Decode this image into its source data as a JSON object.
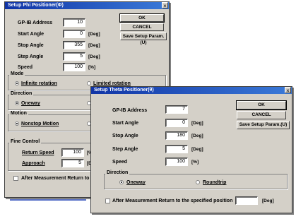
{
  "phi": {
    "title": "Setup Phi Positioner(Φ)",
    "gpib_label": "GP-IB Address",
    "gpib_value": "10",
    "start_label": "Start Angle",
    "start_value": "0",
    "stop_label": "Stop Angle",
    "stop_value": "355",
    "step_label": "Step Angle",
    "step_value": "5",
    "speed_label": "Speed",
    "speed_value": "100",
    "deg_unit": "[Deg]",
    "pct_unit": "[%]",
    "ok": "OK",
    "cancel": "CANCEL",
    "save": "Save Setup Param.(U)",
    "mode_title": "Mode",
    "mode_infinite": "Infinite rotation",
    "mode_limited": "Limited rotation",
    "direction_title": "Direction",
    "direction_oneway": "Oneway",
    "direction_partial": "R",
    "motion_title": "Motion",
    "motion_nonstop": "Nonstop Motion",
    "motion_partial": "S",
    "fine_title": "Fine Control",
    "return_speed_label": "Return Speed",
    "return_speed_value": "100",
    "return_unit_partial": "[%",
    "approach_label": "Approach",
    "approach_value": "5",
    "approach_unit_partial": "[De",
    "after_label": "After Measurement Return to the specified"
  },
  "theta": {
    "title": "Setup Theta Positioner(θ)",
    "gpib_label": "GP-IB Address",
    "gpib_value": "7",
    "start_label": "Start Angle",
    "start_value": "0",
    "stop_label": "Stop Angle",
    "stop_value": "180",
    "step_label": "Step Angle",
    "step_value": "5",
    "speed_label": "Speed",
    "speed_value": "100",
    "deg_unit": "[Deg]",
    "pct_unit": "[%]",
    "ok": "OK",
    "cancel": "CANCEL",
    "save": "Save Setup Param.(U)",
    "direction_title": "Direction",
    "direction_oneway": "Oneway",
    "direction_roundtrip": "Roundtrip",
    "after_label": "After Measurement Return to the specified position",
    "after_value": "",
    "after_unit": "[Deg]"
  }
}
